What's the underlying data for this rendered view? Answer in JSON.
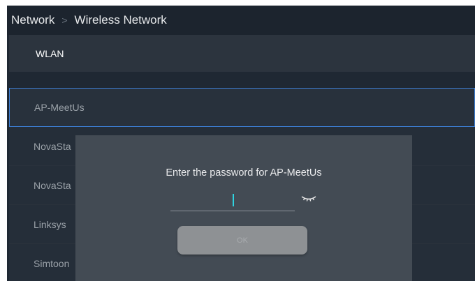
{
  "breadcrumb": {
    "parent": "Network",
    "separator": ">",
    "current": "Wireless Network"
  },
  "wlan": {
    "label": "WLAN"
  },
  "networks": [
    {
      "label": "AP-MeetUs",
      "selected": true
    },
    {
      "label": "NovaSta",
      "selected": false
    },
    {
      "label": "NovaSta",
      "selected": false
    },
    {
      "label": "Linksys",
      "selected": false
    },
    {
      "label": "Simtoon",
      "selected": false
    }
  ],
  "dialog": {
    "title": "Enter the password for AP-MeetUs",
    "password_value": "",
    "eye_icon": "eye-closed-icon",
    "ok_label": "OK"
  },
  "colors": {
    "accent": "#3d7fd6",
    "caret": "#2fd3e0"
  }
}
